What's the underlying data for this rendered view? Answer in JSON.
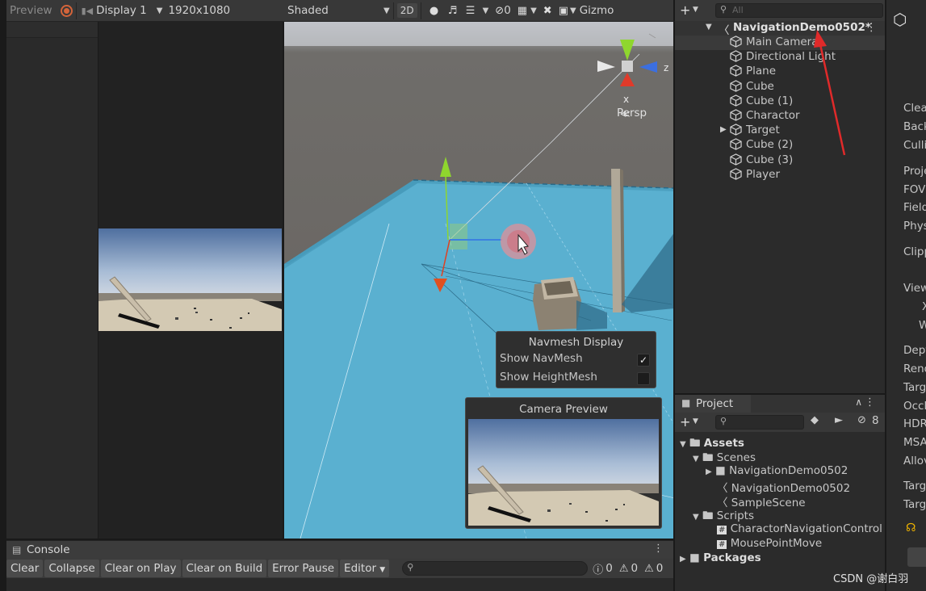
{
  "game_view": {
    "preview_label": "Preview",
    "display_label": "Display 1",
    "resolution_label": "1920x1080"
  },
  "scene_view": {
    "shading_mode": "Shaded",
    "mode_2d": "2D",
    "hidden_count": "0",
    "gizmos_label": "Gizmo",
    "persp_label": "Persp",
    "axis_y": "y",
    "axis_z": "z",
    "axis_x": "x"
  },
  "navmesh_display": {
    "title": "Navmesh Display",
    "show_navmesh_label": "Show NavMesh",
    "show_navmesh_checked": true,
    "show_heightmesh_label": "Show HeightMesh",
    "show_heightmesh_checked": false
  },
  "camera_preview": {
    "title": "Camera Preview"
  },
  "console": {
    "tab_label": "Console",
    "buttons": [
      "Clear",
      "Collapse",
      "Clear on Play",
      "Clear on Build",
      "Error Pause",
      "Editor"
    ],
    "log_count": "0",
    "warn_count": "0",
    "error_count": "0"
  },
  "hierarchy": {
    "search_placeholder": "All",
    "scene_name": "NavigationDemo0502*",
    "items": [
      "Main Camera",
      "Directional Light",
      "Plane",
      "Cube",
      "Cube (1)",
      "Charactor",
      "Target",
      "Cube (2)",
      "Cube (3)",
      "Player"
    ]
  },
  "project": {
    "tab_label": "Project",
    "hidden_count": "8",
    "assets_label": "Assets",
    "scenes_label": "Scenes",
    "scene_folder": "NavigationDemo0502",
    "scene_file": "NavigationDemo0502",
    "sample_scene": "SampleScene",
    "scripts_label": "Scripts",
    "script_1": "CharactorNavigationControl",
    "script_2": "MousePointMove",
    "packages_label": "Packages"
  },
  "inspector": {
    "labels": [
      "Clea",
      "Back",
      "Culli",
      "Proje",
      "FOV",
      "Field",
      "Phys",
      "Clipp",
      "View",
      "X",
      "W",
      "Dept",
      "Rend",
      "Targ",
      "Occl",
      "HDR",
      "MSA",
      "Allov",
      "Targ",
      "Targ"
    ]
  },
  "watermark": "CSDN @谢白羽",
  "colors": {
    "selection": "#3a3a3a",
    "plane_blue": "#5ab0d0",
    "red_arrow": "#e03030"
  }
}
